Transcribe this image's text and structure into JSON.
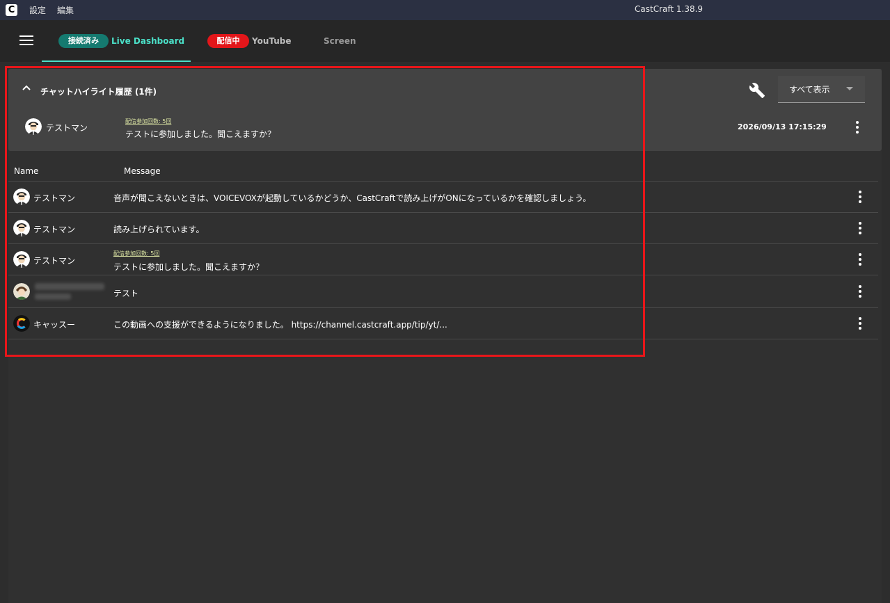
{
  "titlebar": {
    "logo": "C",
    "menu": [
      "設定",
      "編集"
    ],
    "title": "CastCraft 1.38.9"
  },
  "tabs": [
    {
      "badge": "接続済み",
      "label": "Live Dashboard",
      "active": true
    },
    {
      "badge": "配信中",
      "label": "YouTube"
    },
    {
      "label": "Screen"
    }
  ],
  "highlight": {
    "title": "チャットハイライト履歴 (1件)",
    "filter_value": "すべて表示",
    "row": {
      "name": "テストマン",
      "badge": "配信参加回数: 5回",
      "message": "テストに参加しました。聞こえますか？",
      "time": "2026/09/13 17:15:29"
    }
  },
  "table": {
    "columns": [
      "Name",
      "Message"
    ],
    "rows": [
      {
        "name": "テストマン",
        "message": "音声が聞こえないときは、VOICEVOXが起動しているかどうか、CastCraftで読み上げがONになっているかを確認しましょう。"
      },
      {
        "name": "テストマン",
        "message": "読み上げられています。"
      },
      {
        "name": "テストマン",
        "badge": "配信参加回数: 5回",
        "message": "テストに参加しました。聞こえますか？"
      },
      {
        "name": "",
        "message": "テスト"
      },
      {
        "name": "キャッスー",
        "message": "この動画への支援ができるようになりました。 https://channel.castcraft.app/tip/yt/..."
      }
    ]
  },
  "colors": {
    "accent": "#4be0c8",
    "live": "#e3161a",
    "annotation": "#e8161a"
  },
  "icons": [
    "menu-icon",
    "chevron-up-icon",
    "wrench-icon",
    "caret-down-icon",
    "more-vert-icon"
  ]
}
